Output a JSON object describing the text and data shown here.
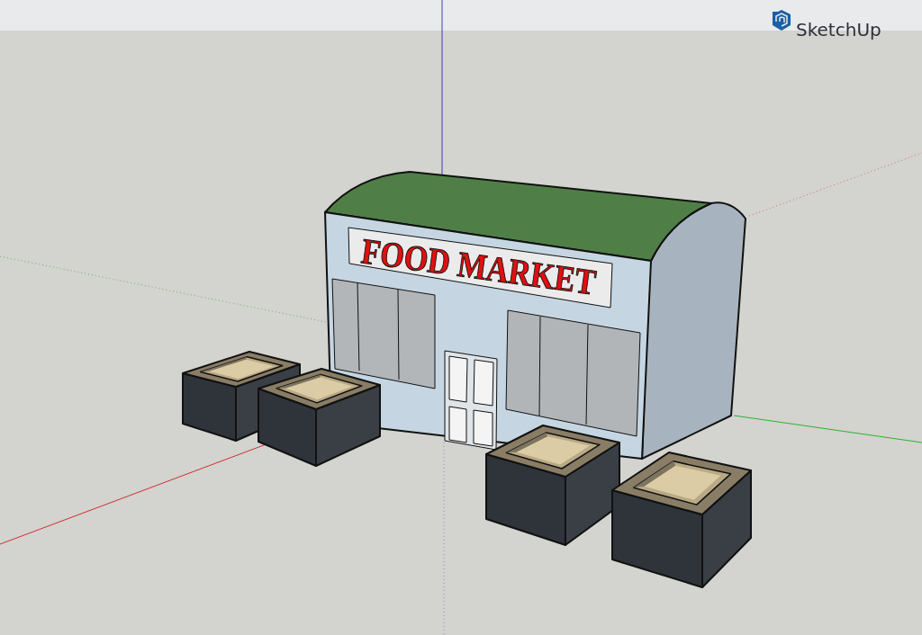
{
  "app": {
    "name": "SketchUp"
  },
  "model": {
    "sign_text": "FOOD MARKET"
  }
}
